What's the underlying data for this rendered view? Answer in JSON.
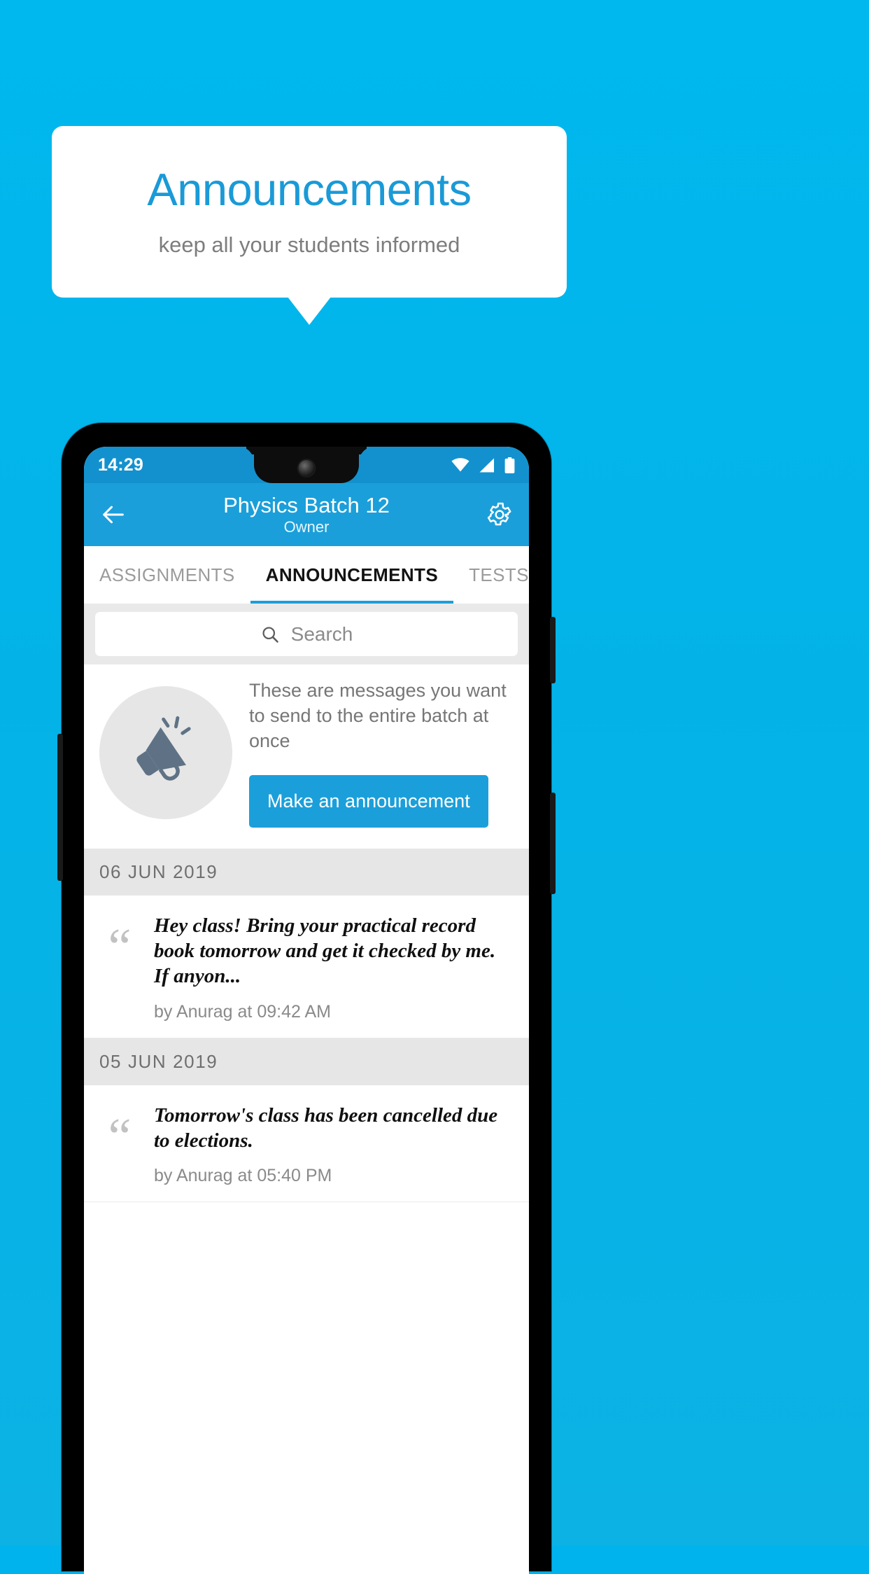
{
  "promo": {
    "title": "Announcements",
    "subtitle": "keep all your students informed"
  },
  "phone": {
    "status": {
      "time": "14:29",
      "icons": [
        "wifi-icon",
        "signal-icon",
        "battery-icon"
      ]
    },
    "appbar": {
      "back_icon": "back-arrow-icon",
      "title": "Physics Batch 12",
      "subtitle": "Owner",
      "settings_icon": "gear-icon"
    },
    "tabs": [
      {
        "label": "ASSIGNMENTS",
        "active": false
      },
      {
        "label": "ANNOUNCEMENTS",
        "active": true
      },
      {
        "label": "TESTS",
        "active": false
      },
      {
        "label": "\\",
        "active": false
      }
    ],
    "search": {
      "icon": "search-icon",
      "placeholder": "Search",
      "value": ""
    },
    "empty_state": {
      "icon": "megaphone-icon",
      "description": "These are messages you want to send to the entire batch at once",
      "button_label": "Make an announcement"
    },
    "groups": [
      {
        "date": "06  JUN  2019",
        "items": [
          {
            "text": "Hey class! Bring your practical record book tomorrow and get it checked by me. If anyon...",
            "meta": "by Anurag at 09:42 AM"
          }
        ]
      },
      {
        "date": "05  JUN  2019",
        "items": [
          {
            "text": "Tomorrow's class has been cancelled due to elections.",
            "meta": "by Anurag at 05:40 PM"
          }
        ]
      }
    ]
  },
  "colors": {
    "brand": "#00b3ec",
    "accent": "#1b9fda",
    "statusbar": "#1391ce",
    "title": "#1a9ad7"
  }
}
